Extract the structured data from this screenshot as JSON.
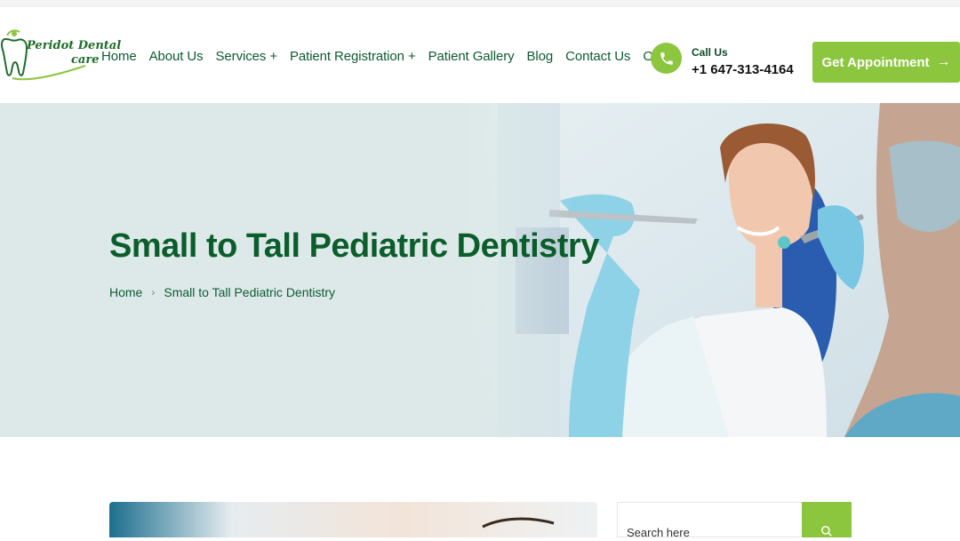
{
  "header": {
    "logo": {
      "line1": "Peridot Dental",
      "line2": "care"
    },
    "nav": [
      {
        "label": "Home"
      },
      {
        "label": "About Us"
      },
      {
        "label": "Services +"
      },
      {
        "label": "Patient Registration +"
      },
      {
        "label": "Patient Gallery"
      },
      {
        "label": "Blog"
      },
      {
        "label": "Contact Us"
      },
      {
        "label": "ODA"
      }
    ],
    "call": {
      "label": "Call Us",
      "number": "+1 647-313-4164",
      "icon": "phone-icon"
    },
    "cta": {
      "label": "Get Appointment",
      "arrow": "→"
    }
  },
  "hero": {
    "title": "Small to Tall Pediatric Dentistry",
    "breadcrumb": {
      "home": "Home",
      "separator": "›",
      "current": "Small to Tall Pediatric Dentistry"
    }
  },
  "sidebar": {
    "search": {
      "placeholder": "Search here",
      "icon": "search-icon"
    }
  },
  "colors": {
    "accent_green": "#8cc63e",
    "dark_green": "#0b5d2c",
    "hero_bg": "#dde9e8"
  }
}
